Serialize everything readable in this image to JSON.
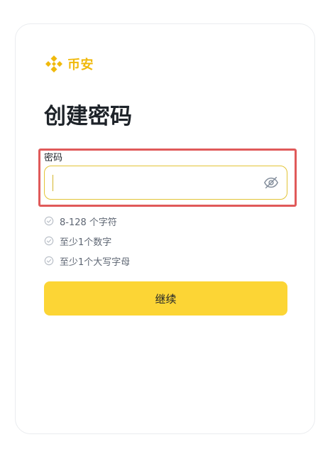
{
  "brand": {
    "name": "币安",
    "color": "#f0b90b"
  },
  "page": {
    "title": "创建密码"
  },
  "password_field": {
    "label": "密码",
    "value": "",
    "placeholder": "",
    "toggle_icon": "eye-off-icon"
  },
  "requirements": [
    {
      "text": "8-128 个字符",
      "icon": "check-circle-icon"
    },
    {
      "text": "至少1个数字",
      "icon": "check-circle-icon"
    },
    {
      "text": "至少1个大写字母",
      "icon": "check-circle-icon"
    }
  ],
  "actions": {
    "continue_label": "继续",
    "button_color": "#fcd535"
  },
  "colors": {
    "highlight_border": "#e05a5a",
    "input_focus_border": "#e3c436"
  }
}
